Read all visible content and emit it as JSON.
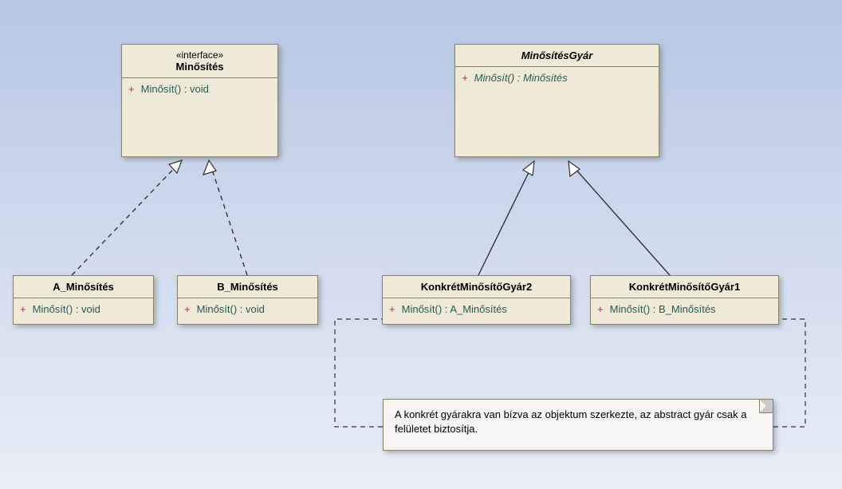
{
  "diagram": {
    "interface": {
      "stereotype": "«interface»",
      "name": "Minősítés",
      "op": "Minősít() : void"
    },
    "factory": {
      "name": "MinősítésGyár",
      "op": "Minősít() : Minősítés"
    },
    "a_rating": {
      "name": "A_Minősítés",
      "op": "Minősít() : void"
    },
    "b_rating": {
      "name": "B_Minősítés",
      "op": "Minősít() : void"
    },
    "factory2": {
      "name": "KonkrétMinősítőGyár2",
      "op": "Minősít() : A_Minősítés"
    },
    "factory1": {
      "name": "KonkrétMinősítőGyár1",
      "op": "Minősít() : B_Minősítés"
    },
    "note": {
      "text": "A konkrét gyárakra van bízva az objektum szerkezte, az abstract gyár csak a felületet biztosítja."
    },
    "vis": "+"
  }
}
